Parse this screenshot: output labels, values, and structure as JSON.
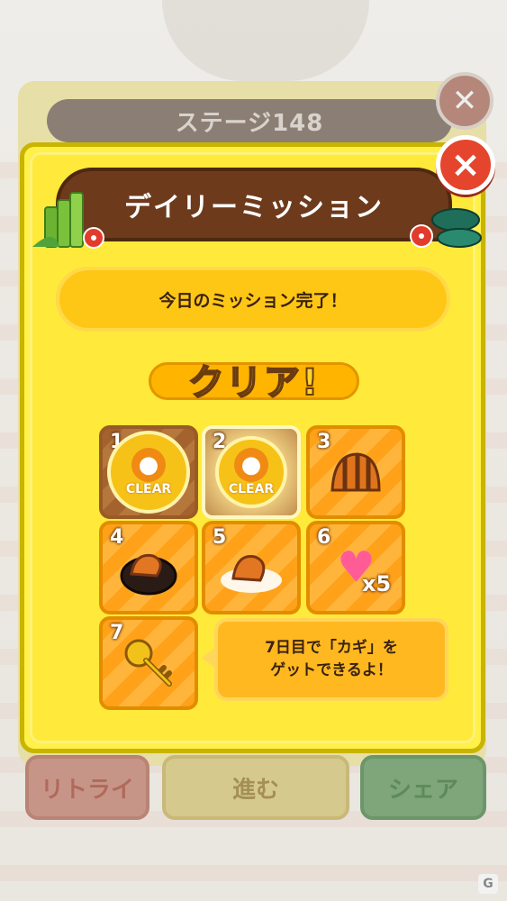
{
  "background": {
    "stage_label": "ステージ148",
    "buttons": [
      {
        "label": "リトライ"
      },
      {
        "label": "進む"
      },
      {
        "label": "シェア"
      }
    ]
  },
  "dialog": {
    "title": "デイリーミッション",
    "close_icon": "×",
    "status": "今日のミッション完了！",
    "clear_banner": "クリア!",
    "days": [
      {
        "number": "1",
        "state": "cleared",
        "badge": "CLEAR",
        "icon": "paw-clear-badge-icon"
      },
      {
        "number": "2",
        "state": "cleared-today",
        "badge": "CLEAR",
        "icon": "paw-clear-badge-icon"
      },
      {
        "number": "3",
        "state": "upcoming",
        "icon": "striped-food-icon"
      },
      {
        "number": "4",
        "state": "upcoming",
        "icon": "food-on-plate-icon"
      },
      {
        "number": "5",
        "state": "upcoming",
        "icon": "food-on-cloud-icon"
      },
      {
        "number": "6",
        "state": "upcoming",
        "icon": "heart-icon",
        "quantity": "x5"
      },
      {
        "number": "7",
        "state": "upcoming",
        "icon": "golden-key-icon"
      }
    ],
    "hint_line1": "7日目で「カギ」を",
    "hint_line2": "ゲットできるよ！"
  },
  "colors": {
    "dialog_bg": "#ffe93a",
    "title_banner": "#6d3a1c",
    "close_button": "#e4452c",
    "status_bar": "#ffc715",
    "cell_orange": "#ffa21a"
  }
}
